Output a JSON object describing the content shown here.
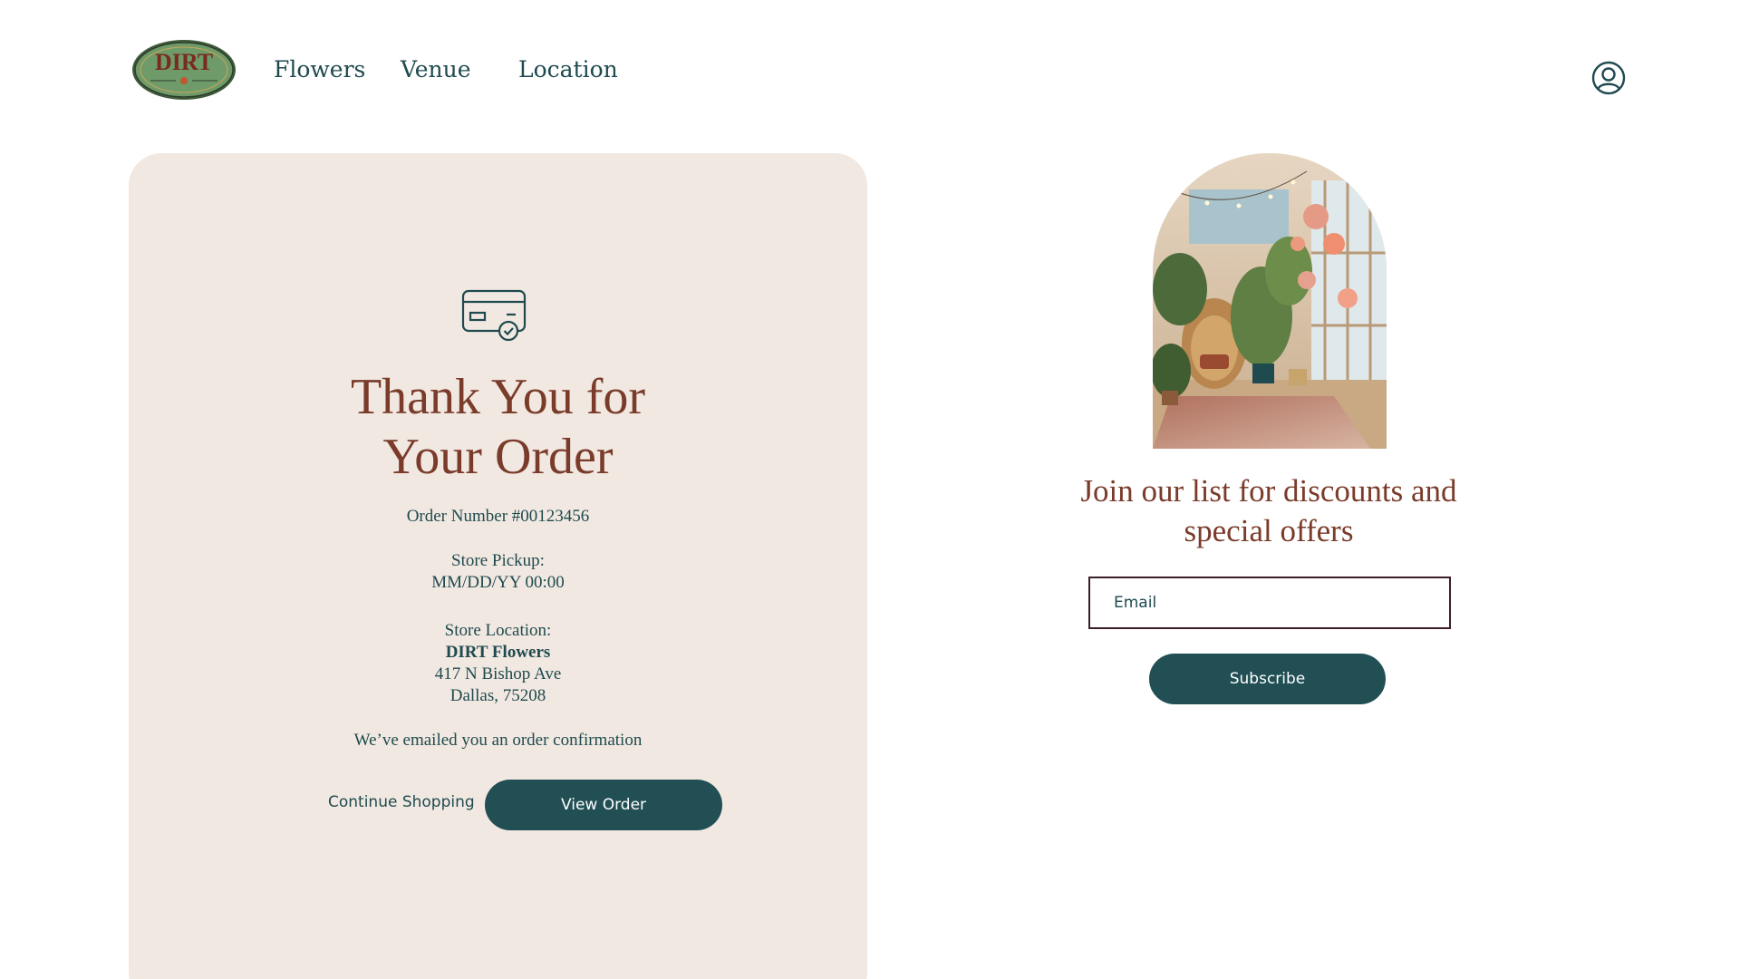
{
  "header": {
    "logo_text": "DIRT",
    "nav": {
      "flowers": "Flowers",
      "venue": "Venue",
      "location": "Location"
    },
    "account_icon": "user-circle-icon"
  },
  "order": {
    "icon": "credit-card-check-icon",
    "title_line1": "Thank You for",
    "title_line2": "Your Order",
    "order_number": "Order Number #00123456",
    "pickup_label": "Store Pickup:",
    "pickup_time": "MM/DD/YY 00:00",
    "location_label": "Store Location:",
    "store_name": "DIRT Flowers",
    "address_line1": "417 N Bishop Ave",
    "address_line2": "Dallas, 75208",
    "emailed_note": "We’ve emailed you an order confirmation",
    "continue_label": "Continue Shopping",
    "view_order_label": "View Order"
  },
  "newsletter": {
    "heading_line1": "Join our list for discounts and",
    "heading_line2": "special offers",
    "email_placeholder": "Email",
    "subscribe_label": "Subscribe"
  },
  "colors": {
    "accent_teal": "#214f54",
    "heading_brown": "#7a3b2a",
    "card_bg": "#f1e8e1",
    "text_teal": "#1f4a4f"
  }
}
